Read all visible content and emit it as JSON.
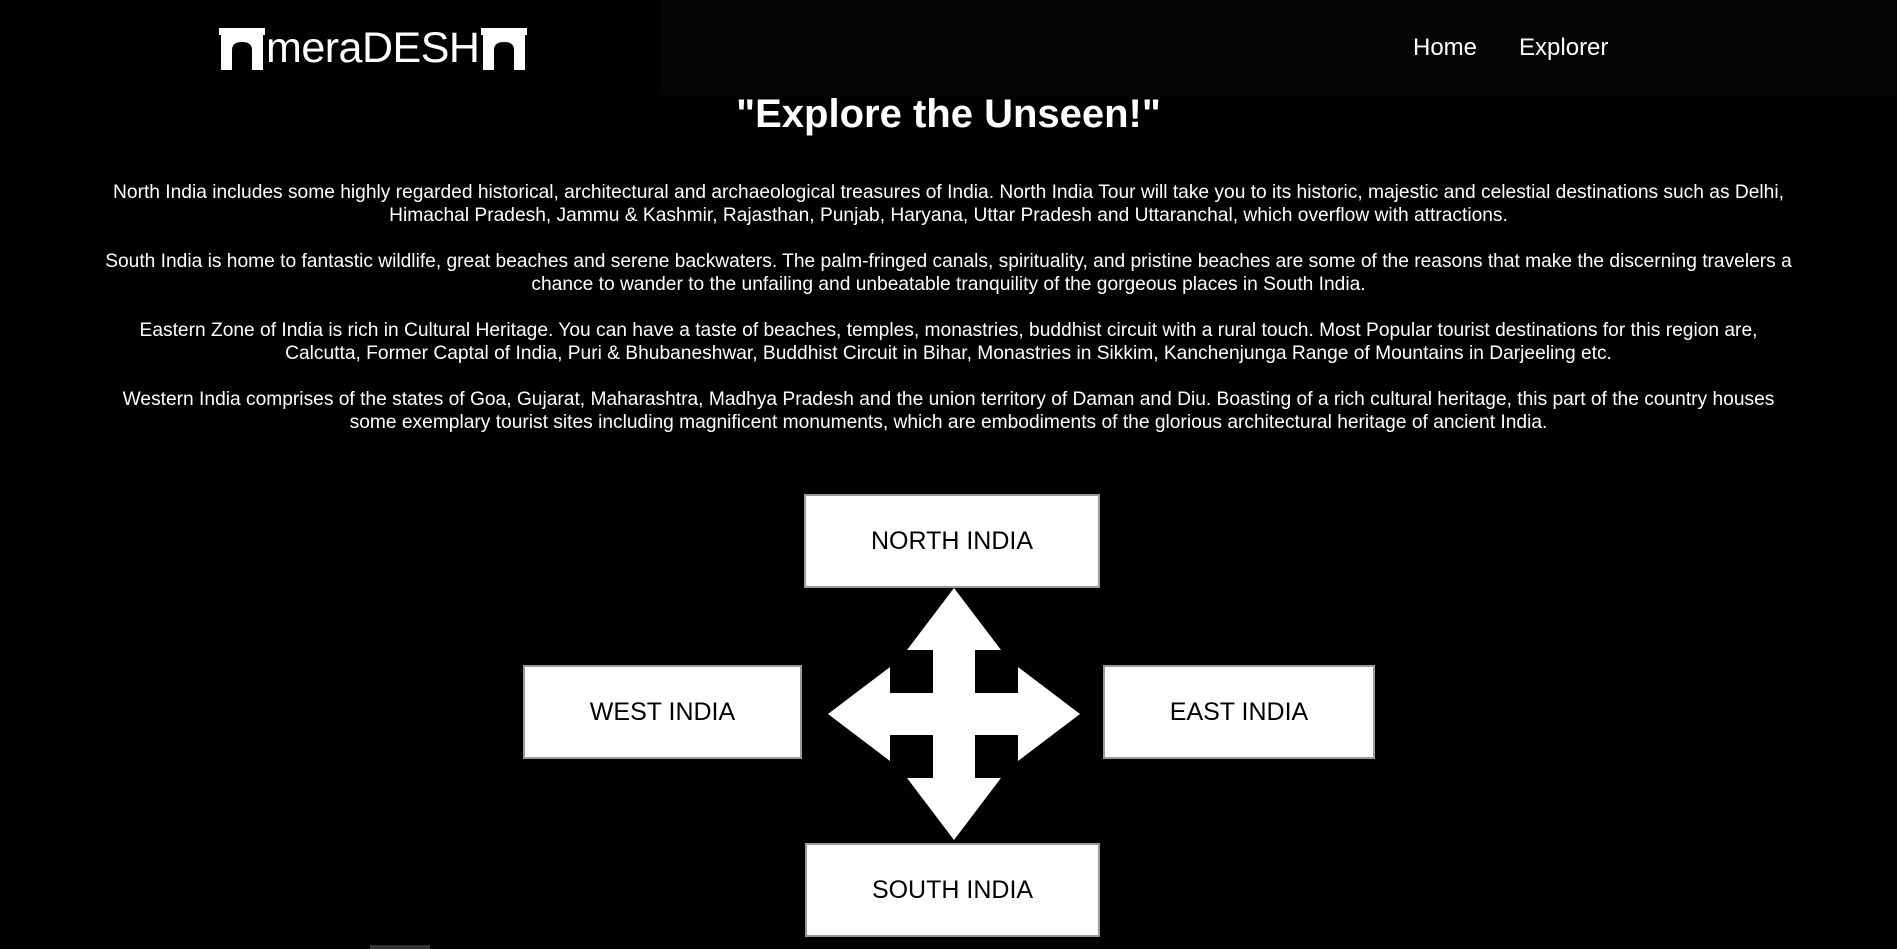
{
  "header": {
    "logo_text": "meraDESH",
    "nav": [
      {
        "label": "Home"
      },
      {
        "label": "Explorer"
      }
    ]
  },
  "main": {
    "headline": "\"Explore the Unseen!\"",
    "paragraphs": [
      "North India includes some highly regarded historical, architectural and archaeological treasures of India. North India Tour will take you to its historic, majestic and celestial destinations such as Delhi, Himachal Pradesh, Jammu & Kashmir, Rajasthan, Punjab, Haryana, Uttar Pradesh and Uttaranchal, which overflow with attractions.",
      "South India is home to fantastic wildlife, great beaches and serene backwaters. The palm-fringed canals, spirituality, and pristine beaches are some of the reasons that make the discerning travelers a chance to wander to the unfailing and unbeatable tranquility of the gorgeous places in South India.",
      "Eastern Zone of India is rich in Cultural Heritage. You can have a taste of beaches, temples, monastries, buddhist circuit with a rural touch. Most Popular tourist destinations for this region are, Calcutta, Former Captal of India, Puri & Bhubaneshwar, Buddhist Circuit in Bihar, Monastries in Sikkim, Kanchenjunga Range of Mountains in Darjeeling etc.",
      "Western India comprises of the states of Goa, Gujarat, Maharashtra, Madhya Pradesh and the union territory of Daman and Diu. Boasting of a rich cultural heritage, this part of the country houses some exemplary tourist sites including magnificent monuments, which are embodiments of the glorious architectural heritage of ancient India."
    ],
    "regions": {
      "north": "NORTH INDIA",
      "west": "WEST INDIA",
      "east": "EAST INDIA",
      "south": "SOUTH INDIA"
    },
    "compass_icon": "four-way-arrow-icon"
  },
  "colors": {
    "background": "#000000",
    "text": "#ffffff",
    "box_background": "#ffffff",
    "box_text": "#000000",
    "box_border": "#9a9a9a"
  }
}
